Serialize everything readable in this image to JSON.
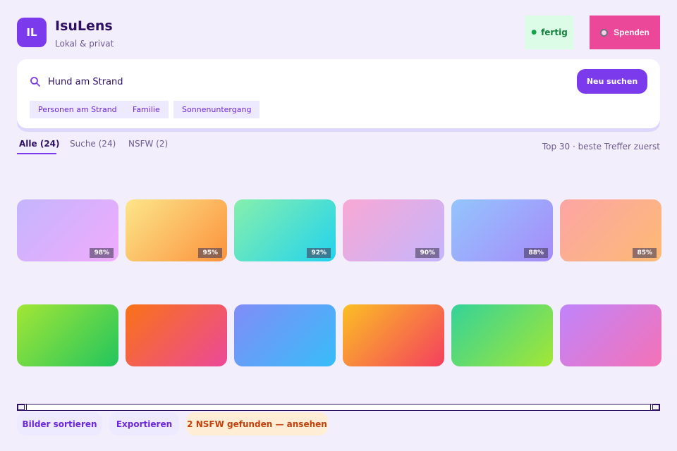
{
  "app": {
    "logo_text": "IL",
    "title": "IsuLens",
    "subtitle": "Lokal & privat"
  },
  "status": {
    "label": "fertig",
    "color": "#16a34a"
  },
  "donate": {
    "label": "Spenden",
    "icon": "camera-icon"
  },
  "search": {
    "icon": "search-icon",
    "value": "Hund am Strand",
    "button_label": "Neu suchen",
    "chips": [
      "Personen am Strand",
      "Familie",
      "Sonnenuntergang"
    ]
  },
  "tabs": [
    {
      "label": "Alle (24)",
      "active": true
    },
    {
      "label": "Suche (24)",
      "active": false
    },
    {
      "label": "NSFW (2)",
      "active": false
    }
  ],
  "results_hint": "Top 30 · beste Treffer zuerst",
  "thumbnails": [
    {
      "colors": [
        "#c4b5fd",
        "#f0abfc"
      ],
      "score": "98%"
    },
    {
      "colors": [
        "#fde68a",
        "#fb923c"
      ],
      "score": "95%"
    },
    {
      "colors": [
        "#86efac",
        "#22d3ee"
      ],
      "score": "92%"
    },
    {
      "colors": [
        "#f9a8d4",
        "#c4b5fd"
      ],
      "score": "90%"
    },
    {
      "colors": [
        "#93c5fd",
        "#a78bfa"
      ],
      "score": "88%"
    },
    {
      "colors": [
        "#fca5a5",
        "#fdba74"
      ],
      "score": "85%"
    },
    {
      "colors": [
        "#a3e635",
        "#22c55e"
      ],
      "score": ""
    },
    {
      "colors": [
        "#f97316",
        "#ec4899"
      ],
      "score": ""
    },
    {
      "colors": [
        "#818cf8",
        "#38bdf8"
      ],
      "score": ""
    },
    {
      "colors": [
        "#fbbf24",
        "#f43f5e"
      ],
      "score": ""
    },
    {
      "colors": [
        "#34d399",
        "#a3e635"
      ],
      "score": ""
    },
    {
      "colors": [
        "#c084fc",
        "#f472b6"
      ],
      "score": ""
    }
  ],
  "footer": {
    "sort_label": "Bilder sortieren",
    "export_label": "Exportieren",
    "nsfw_label": "2 NSFW gefunden — ansehen"
  },
  "colors": {
    "accent": "#7c3aed",
    "donate": "#ec4899",
    "background": "#f3eefc"
  }
}
